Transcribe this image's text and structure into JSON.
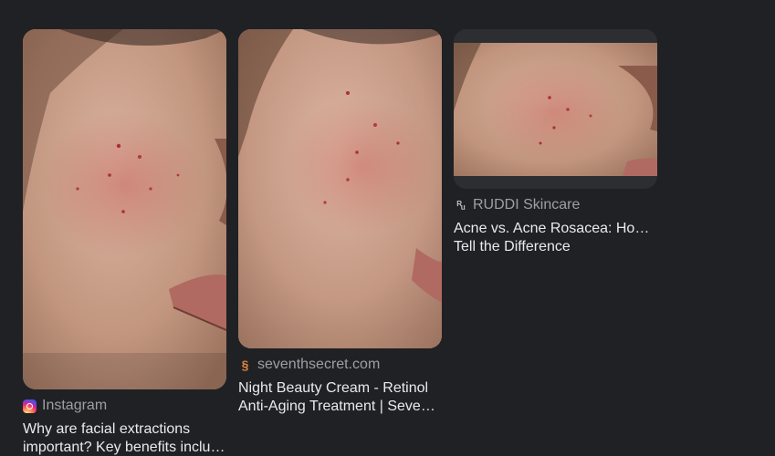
{
  "results": [
    {
      "source": "Instagram",
      "favicon": "instagram-icon",
      "title_lines": [
        "Why are facial extractions",
        "important? Key benefits includ..."
      ]
    },
    {
      "source": "seventhsecret.com",
      "favicon": "seventhsecret-icon",
      "title_lines": [
        "Night Beauty Cream - Retinol",
        "Anti-Aging Treatment | Sevent..."
      ]
    },
    {
      "source": "RUDDI Skincare",
      "favicon": "ruddi-icon",
      "title_lines": [
        "Acne vs. Acne Rosacea: How to",
        "Tell the Difference"
      ]
    }
  ],
  "colors": {
    "background": "#202124",
    "source_text": "#9aa0a6",
    "title_text": "#e8eaed",
    "skin": "#c69d86"
  }
}
